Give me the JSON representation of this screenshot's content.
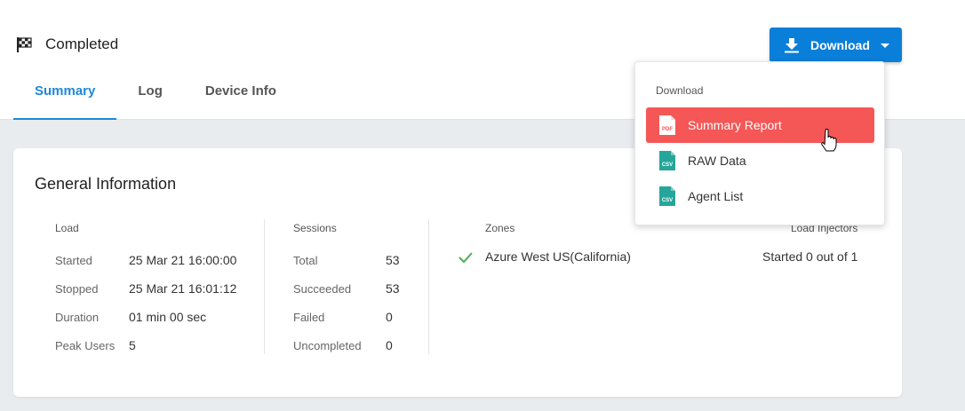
{
  "header": {
    "status": "Completed",
    "status_icon": "checkered-flag-icon"
  },
  "tabs": [
    {
      "label": "Summary",
      "active": true
    },
    {
      "label": "Log",
      "active": false
    },
    {
      "label": "Device Info",
      "active": false
    }
  ],
  "download_button": {
    "label": "Download",
    "icon": "download-icon",
    "color": "#0a7fd9"
  },
  "dropdown": {
    "header": "Download",
    "items": [
      {
        "label": "Summary Report",
        "icon": "pdf-file-icon",
        "icon_text": "PDF",
        "selected": true
      },
      {
        "label": "RAW Data",
        "icon": "csv-file-icon",
        "icon_text": "CSV",
        "selected": false
      },
      {
        "label": "Agent List",
        "icon": "csv-file-icon",
        "icon_text": "CSV",
        "selected": false
      }
    ],
    "highlight_color": "#f55656"
  },
  "general_info": {
    "title": "General Information",
    "load": {
      "heading": "Load",
      "rows": [
        {
          "label": "Started",
          "value": "25 Mar 21 16:00:00"
        },
        {
          "label": "Stopped",
          "value": "25 Mar 21 16:01:12"
        },
        {
          "label": "Duration",
          "value": "01 min 00 sec"
        },
        {
          "label": "Peak Users",
          "value": "5"
        }
      ]
    },
    "sessions": {
      "heading": "Sessions",
      "rows": [
        {
          "label": "Total",
          "value": "53"
        },
        {
          "label": "Succeeded",
          "value": "53"
        },
        {
          "label": "Failed",
          "value": "0"
        },
        {
          "label": "Uncompleted",
          "value": "0"
        }
      ]
    },
    "zones": {
      "heading": "Zones",
      "injectors_heading": "Load Injectors",
      "zone_name": "Azure West US(California)",
      "zone_status": "Started 0 out of 1",
      "status_color": "#4caf50"
    }
  }
}
